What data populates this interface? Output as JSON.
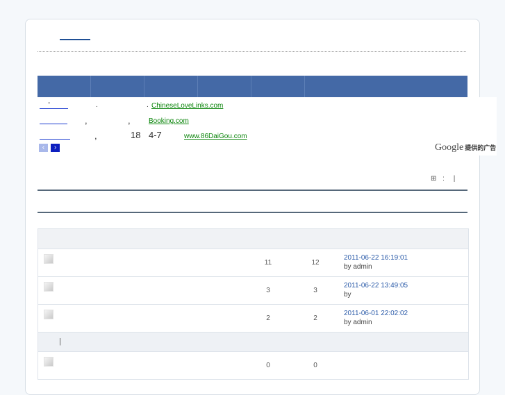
{
  "ads": {
    "lines": [
      {
        "mark": "-",
        "mid": ".",
        "mid2": ".",
        "url": "ChineseLoveLinks.com"
      },
      {
        "mark": "",
        "mid": ",",
        "mid2": ",",
        "url": "Booking.com"
      },
      {
        "mark": "",
        "mid": ",",
        "mid2": "18",
        "mid3": "4-7",
        "url": "www.86DaiGou.com"
      }
    ],
    "google": "Google",
    "google_sub": "提供的广告",
    "prev_glyph": "‹",
    "next_glyph": "›"
  },
  "toolbar": {
    "grid_glyph": "⊞",
    "colon": ":",
    "pipe": "|"
  },
  "threads": [
    {
      "replies": "11",
      "views": "12",
      "date": "2011-06-22 16:19:01",
      "by": "by admin"
    },
    {
      "replies": "3",
      "views": "3",
      "date": "2011-06-22 13:49:05",
      "by": "by"
    },
    {
      "replies": "2",
      "views": "2",
      "date": "2011-06-01 22:02:02",
      "by": "by admin"
    }
  ],
  "section": {
    "sep": "|"
  },
  "thread_after": {
    "replies": "0",
    "views": "0"
  },
  "colors": {
    "nav": "#4469a6",
    "link": "#2a5aa8",
    "ad_url": "#098409"
  }
}
